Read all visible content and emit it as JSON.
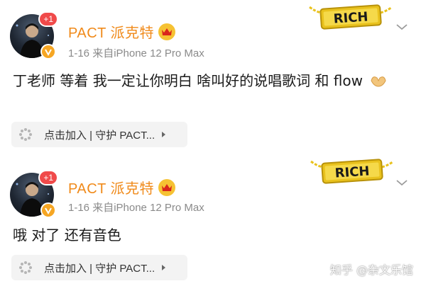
{
  "posts": [
    {
      "notification_count": "+1",
      "author_name": "PACT 派克特",
      "meta": "1-16  来自iPhone 12 Pro Max",
      "badge_text": "RICH",
      "content": "丁老师 等着 我一定让你明白 啥叫好的说唱歌词 和 flow",
      "content_emoji": "palms-up-hands-icon",
      "join_label": "点击加入 | 守护 PACT..."
    },
    {
      "notification_count": "+1",
      "author_name": "PACT 派克特",
      "meta": "1-16  来自iPhone 12 Pro Max",
      "badge_text": "RICH",
      "content": "哦 对了 还有音色",
      "join_label": "点击加入 | 守护 PACT..."
    }
  ],
  "watermark": "知乎 @杂文乐馆",
  "colors": {
    "author_name": "#f08a1a",
    "meta": "#8a8a8a",
    "badge_red": "#f04a4a",
    "verified_gold": "#f6a623",
    "rich_gold": "#e9c21d"
  }
}
